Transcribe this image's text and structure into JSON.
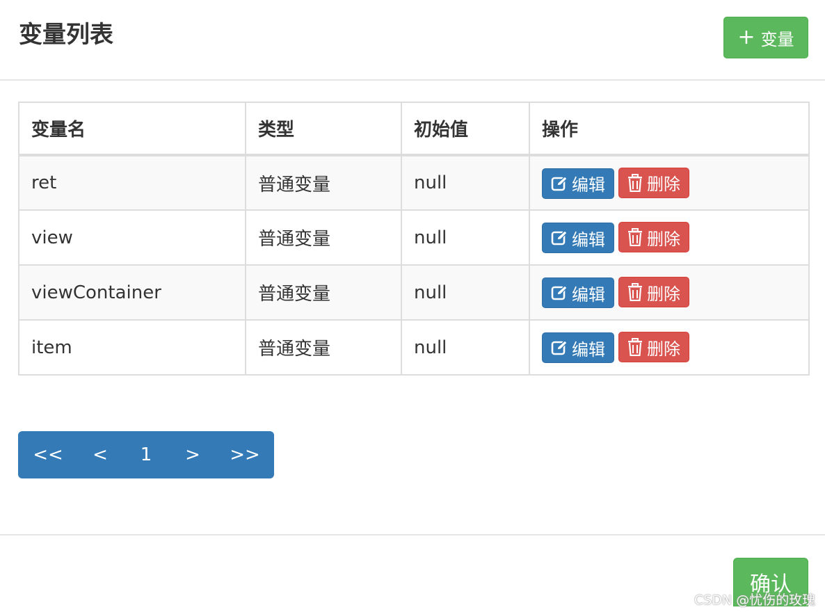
{
  "header": {
    "title": "变量列表",
    "add_button_label": "变量"
  },
  "table": {
    "columns": [
      "变量名",
      "类型",
      "初始值",
      "操作"
    ],
    "rows": [
      {
        "name": "ret",
        "type": "普通变量",
        "initial": "null"
      },
      {
        "name": "view",
        "type": "普通变量",
        "initial": "null"
      },
      {
        "name": "viewContainer",
        "type": "普通变量",
        "initial": "null"
      },
      {
        "name": "item",
        "type": "普通变量",
        "initial": "null"
      }
    ],
    "edit_label": "编辑",
    "delete_label": "删除"
  },
  "pagination": {
    "first": "<<",
    "prev": "<",
    "current": "1",
    "next": ">",
    "last": ">>"
  },
  "footer": {
    "confirm_label": "确认"
  },
  "watermark": "CSDN @忧伤的玫瑰",
  "colors": {
    "success": "#5cb85c",
    "primary": "#337ab7",
    "danger": "#d9534f"
  },
  "icons": {
    "add": "plus-icon",
    "edit": "edit-icon",
    "delete": "trash-icon"
  }
}
